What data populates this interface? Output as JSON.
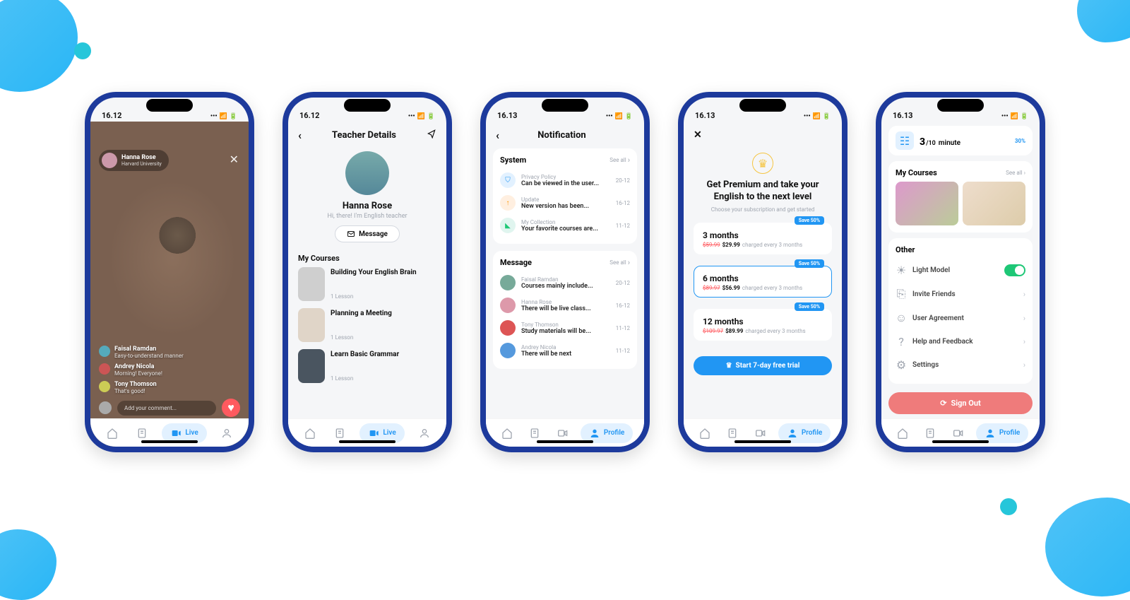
{
  "colors": {
    "primary": "#2196f3",
    "danger": "#ef7b7b",
    "accent_green": "#1ec776",
    "gold": "#f5c542"
  },
  "tabs": {
    "live": "Live",
    "profile": "Profile"
  },
  "status": {
    "t1": "16.12",
    "t2": "16.12",
    "t3": "16.13",
    "t4": "16.13",
    "t5": "16.13"
  },
  "screen1": {
    "host_name": "Hanna Rose",
    "host_uni": "Harvard University",
    "comments": [
      {
        "name": "Faisal Ramdan",
        "msg": "Easy-to-understand manner"
      },
      {
        "name": "Andrey Nicola",
        "msg": "Morning! Everyone!"
      },
      {
        "name": "Tony Thomson",
        "msg": "That's good!"
      }
    ],
    "placeholder": "Add your comment..."
  },
  "screen2": {
    "page_title": "Teacher Details",
    "name": "Hanna Rose",
    "desc": "Hi, there! I'm English teacher",
    "message_btn": "Message",
    "section": "My Courses",
    "courses": [
      {
        "title": "Building Your English Brain",
        "lesson": "1 Lesson"
      },
      {
        "title": "Planning a Meeting",
        "lesson": "1 Lesson"
      },
      {
        "title": "Learn Basic Grammar",
        "lesson": "1 Lesson"
      }
    ]
  },
  "screen3": {
    "page_title": "Notification",
    "see_all": "See all",
    "system_title": "System",
    "system": [
      {
        "title": "Privacy Policy",
        "desc": "Can be viewed in the user...",
        "date": "20-12",
        "color": "#e2f1ff",
        "icon": "shield"
      },
      {
        "title": "Update",
        "desc": "New version has been...",
        "date": "16-12",
        "color": "#ffefe0",
        "icon": "arrow-up"
      },
      {
        "title": "My Collection",
        "desc": "Your favorite courses are...",
        "date": "11-12",
        "color": "#e0f5ef",
        "icon": "bookmark"
      }
    ],
    "message_title": "Message",
    "messages": [
      {
        "title": "Faisal Ramdan",
        "desc": "Courses mainly include...",
        "date": "20-12"
      },
      {
        "title": "Hanna Rose",
        "desc": "There will be live class...",
        "date": "16-12"
      },
      {
        "title": "Tony Thomson",
        "desc": "Study materials will be...",
        "date": "11-12"
      },
      {
        "title": "Andrey Nicola",
        "desc": "There will be next",
        "date": "11-12"
      }
    ]
  },
  "screen4": {
    "heading_l1": "Get Premium and take your",
    "heading_l2": "English to the next level",
    "sub": "Choose your subscription and get started",
    "badge": "Save 50%",
    "plans": [
      {
        "name": "3 months",
        "old": "$59.99",
        "new": "$29.99",
        "tail": "charged every 3 months"
      },
      {
        "name": "6 months",
        "old": "$89.97",
        "new": "$56.99",
        "tail": "charged every 3 months"
      },
      {
        "name": "12 months",
        "old": "$109.97",
        "new": "$89.99",
        "tail": "charged every 3 months"
      }
    ],
    "cta": "Start 7-day free trial"
  },
  "screen5": {
    "progress_num": "3",
    "progress_den": "/10",
    "progress_word": "minute",
    "progress_pct": "30%",
    "courses_title": "My Courses",
    "see_all": "See all",
    "other_title": "Other",
    "rows": [
      {
        "label": "Light Model",
        "type": "toggle",
        "icon": "sun"
      },
      {
        "label": "Invite Friends",
        "type": "nav",
        "icon": "gift"
      },
      {
        "label": "User Agreement",
        "type": "nav",
        "icon": "user"
      },
      {
        "label": "Help and Feedback",
        "type": "nav",
        "icon": "help"
      },
      {
        "label": "Settings",
        "type": "nav",
        "icon": "gear"
      }
    ],
    "signout": "Sign Out"
  }
}
